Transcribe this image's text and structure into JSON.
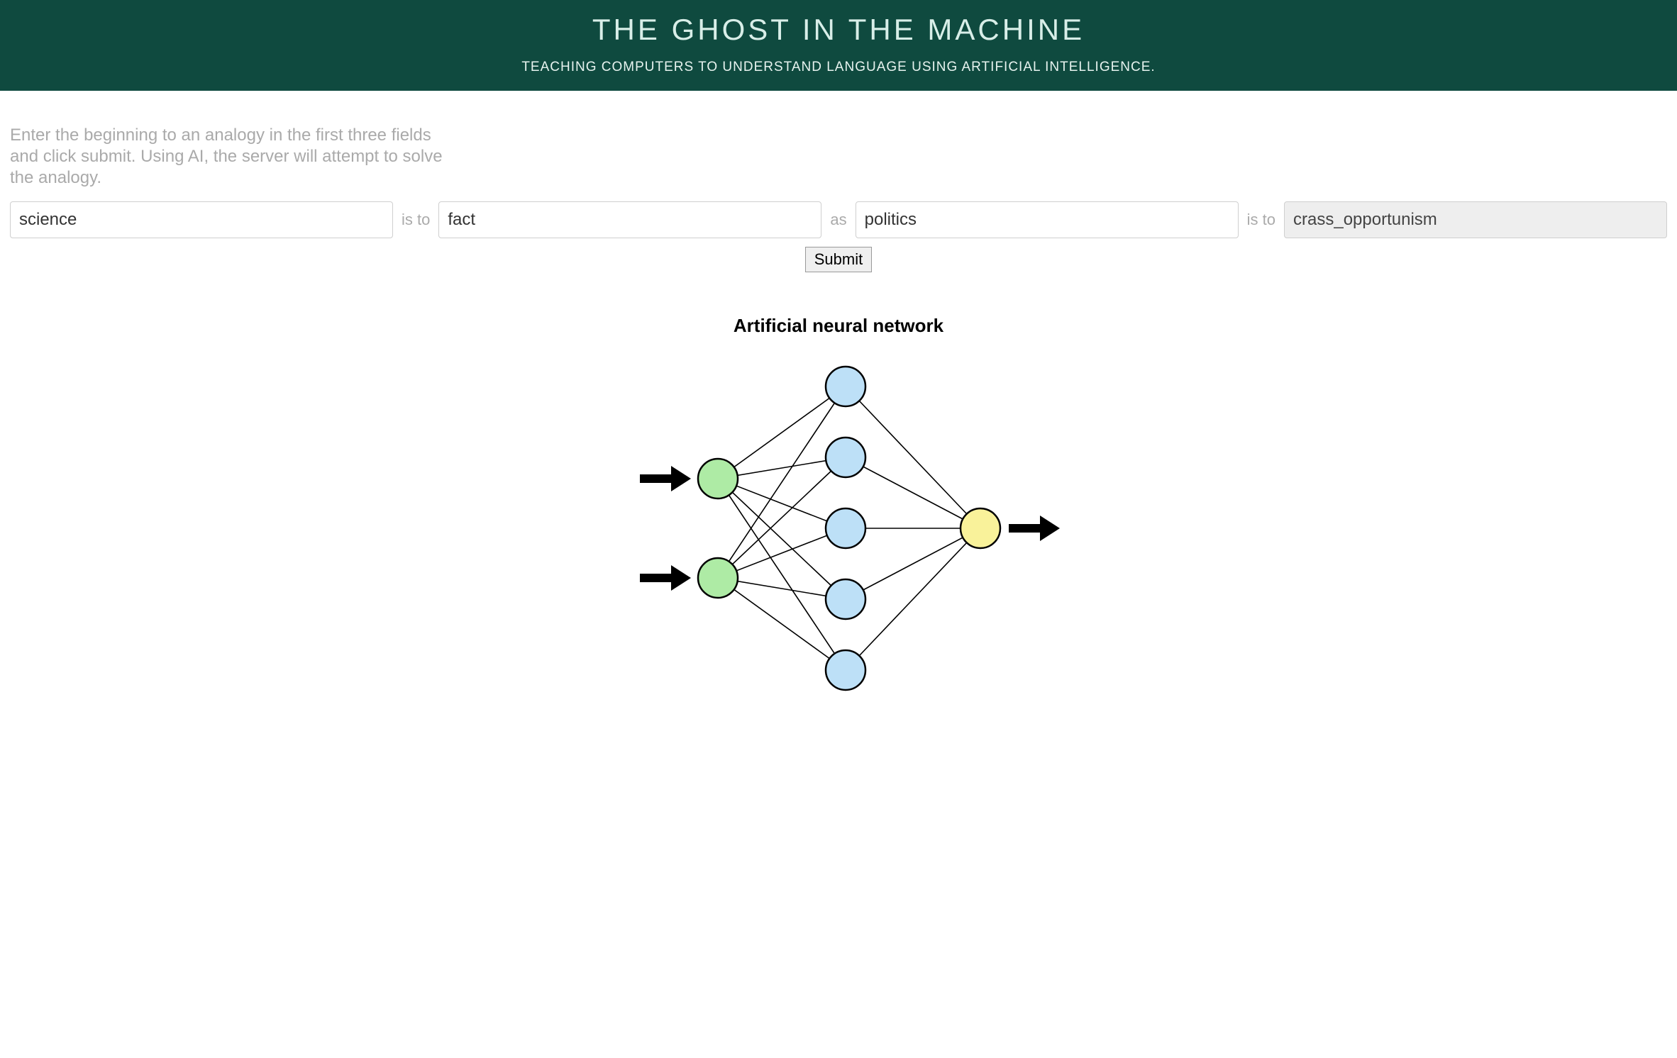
{
  "hero": {
    "title": "THE GHOST IN THE MACHINE",
    "subtitle": "TEACHING COMPUTERS TO UNDERSTAND LANGUAGE USING ARTIFICIAL INTELLIGENCE."
  },
  "intro": "Enter the beginning to an analogy in the first three fields and click submit. Using AI, the server will attempt to solve the analogy.",
  "analogy": {
    "a": "science",
    "sep1": "is to",
    "b": "fact",
    "sep2": "as",
    "c": "politics",
    "sep3": "is to",
    "d": "crass_opportunism"
  },
  "submit_label": "Submit",
  "diagram": {
    "title": "Artificial neural network",
    "input_color": "#aeeba5",
    "hidden_color": "#bde0f7",
    "output_color": "#f9f29a",
    "stroke": "#000000"
  }
}
